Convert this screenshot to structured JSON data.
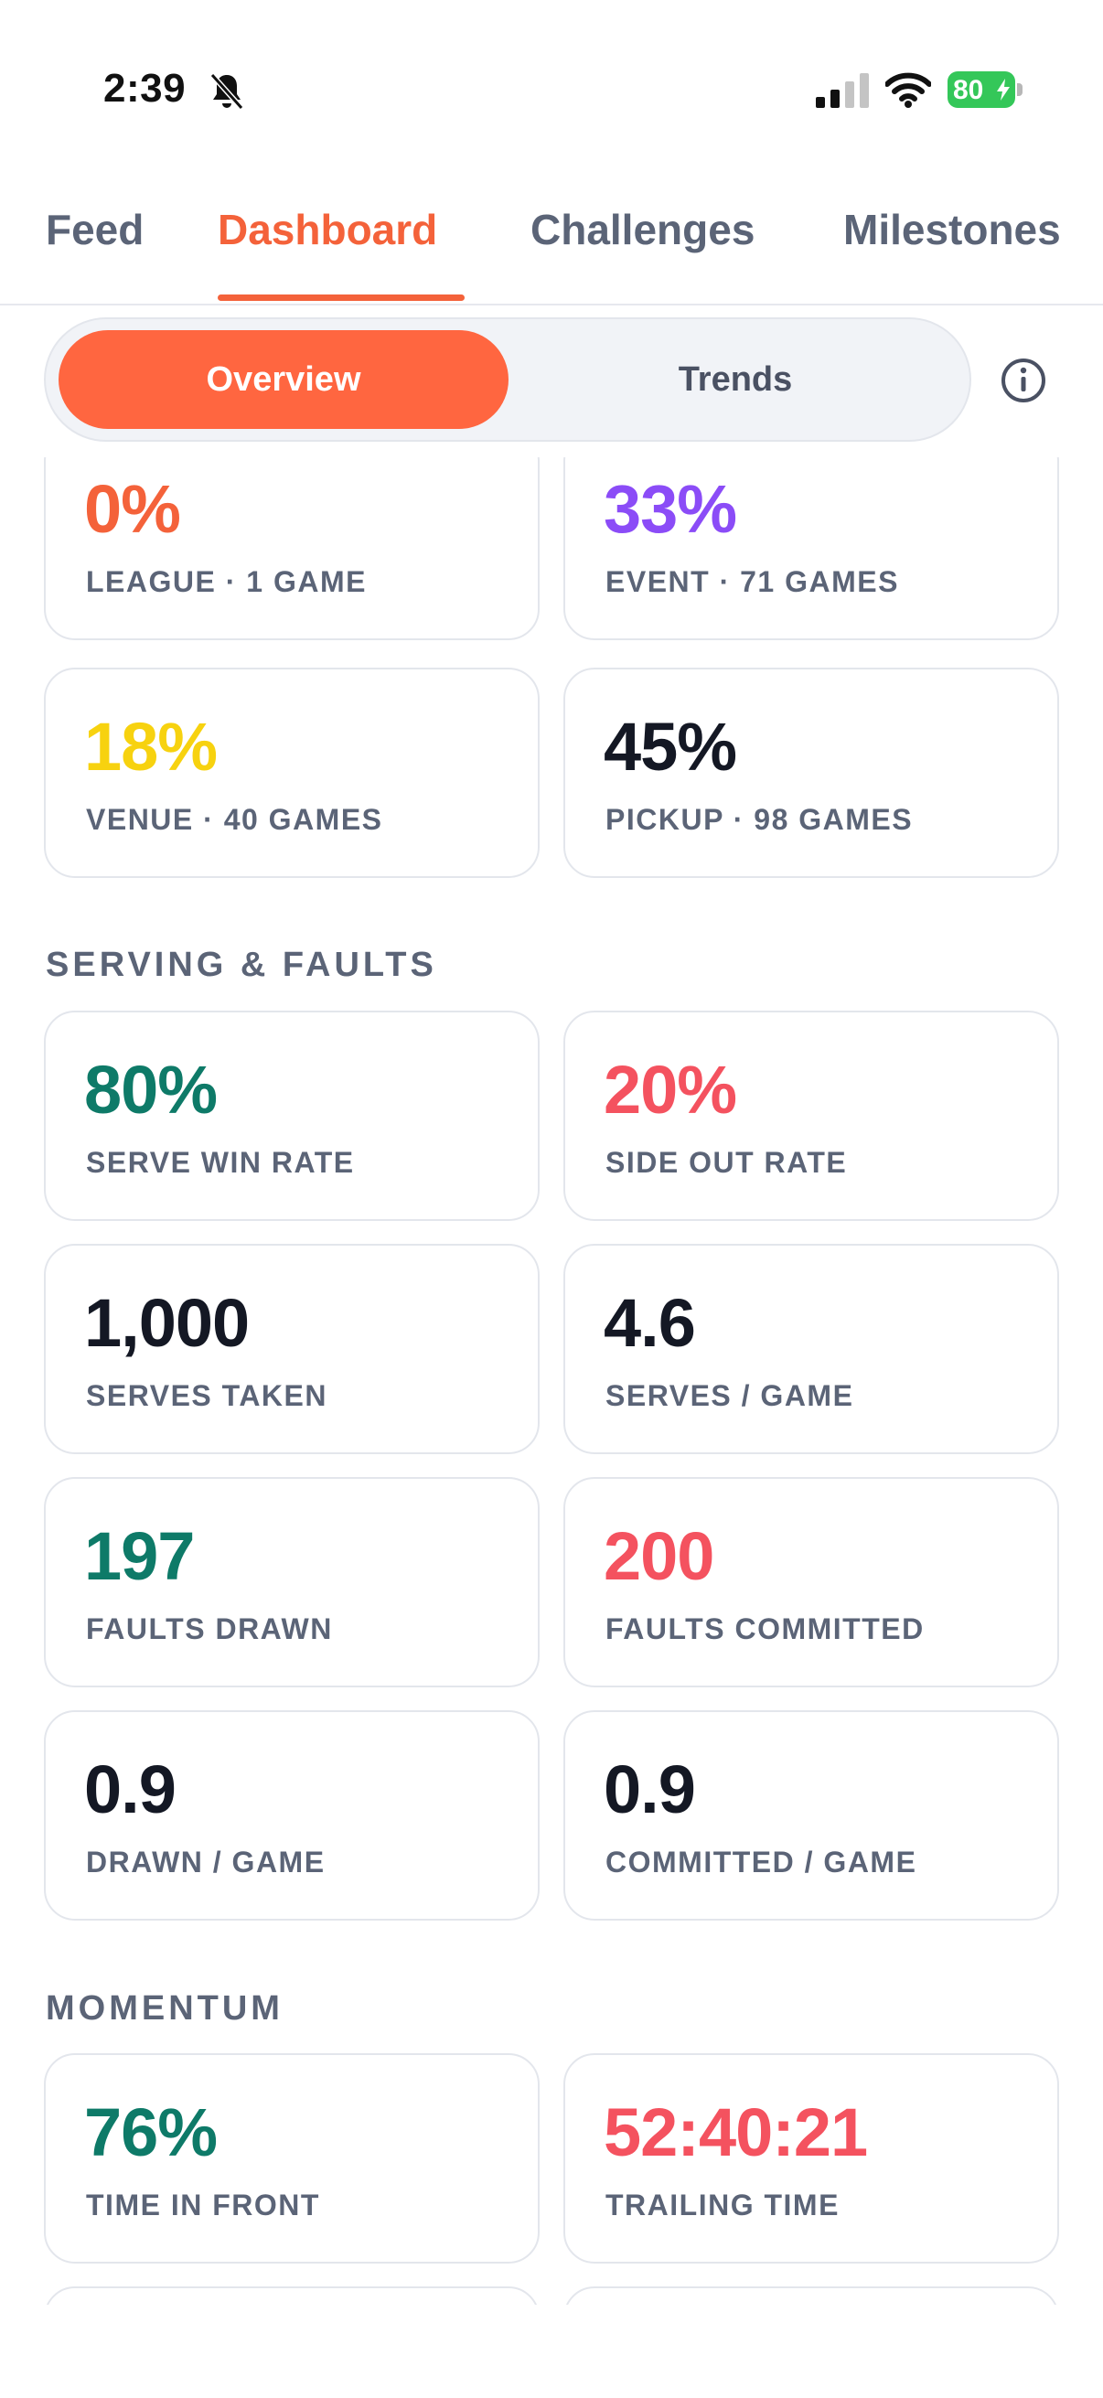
{
  "status_bar": {
    "time": "2:39",
    "battery_level": "80"
  },
  "tabs": [
    {
      "label": "Feed",
      "active": false
    },
    {
      "label": "Dashboard",
      "active": true
    },
    {
      "label": "Challenges",
      "active": false
    },
    {
      "label": "Milestones",
      "active": false
    }
  ],
  "segmented": {
    "overview_label": "Overview",
    "trends_label": "Trends",
    "selected": "Overview"
  },
  "game_types": [
    {
      "value": "0%",
      "label": "LEAGUE · 1 GAME",
      "color": "#f4623a"
    },
    {
      "value": "33%",
      "label": "EVENT · 71 GAMES",
      "color": "#8b4cf7"
    },
    {
      "value": "18%",
      "label": "VENUE · 40 GAMES",
      "color": "#f7d20f"
    },
    {
      "value": "45%",
      "label": "PICKUP · 98 GAMES",
      "color": "#141824"
    }
  ],
  "serving": {
    "title": "SERVING & FAULTS",
    "cards": [
      {
        "value": "80%",
        "label": "SERVE WIN RATE",
        "color": "#0e7a68"
      },
      {
        "value": "20%",
        "label": "SIDE OUT RATE",
        "color": "#f4525f"
      },
      {
        "value": "1,000",
        "label": "SERVES TAKEN",
        "color": "#141824"
      },
      {
        "value": "4.6",
        "label": "SERVES / GAME",
        "color": "#141824"
      },
      {
        "value": "197",
        "label": "FAULTS DRAWN",
        "color": "#0e7a68"
      },
      {
        "value": "200",
        "label": "FAULTS COMMITTED",
        "color": "#f4525f"
      },
      {
        "value": "0.9",
        "label": "DRAWN / GAME",
        "color": "#141824"
      },
      {
        "value": "0.9",
        "label": "COMMITTED / GAME",
        "color": "#141824"
      }
    ]
  },
  "momentum": {
    "title": "MOMENTUM",
    "cards": [
      {
        "value": "76%",
        "label": "TIME IN FRONT",
        "color": "#0e7a68"
      },
      {
        "value": "52:40:21",
        "label": "TRAILING TIME",
        "color": "#f4525f"
      }
    ]
  },
  "icons": {
    "bell": "bell-slash-icon",
    "signal": "cellular-signal-icon",
    "wifi": "wifi-icon",
    "battery": "battery-charging-icon",
    "info": "info-circle-icon"
  }
}
